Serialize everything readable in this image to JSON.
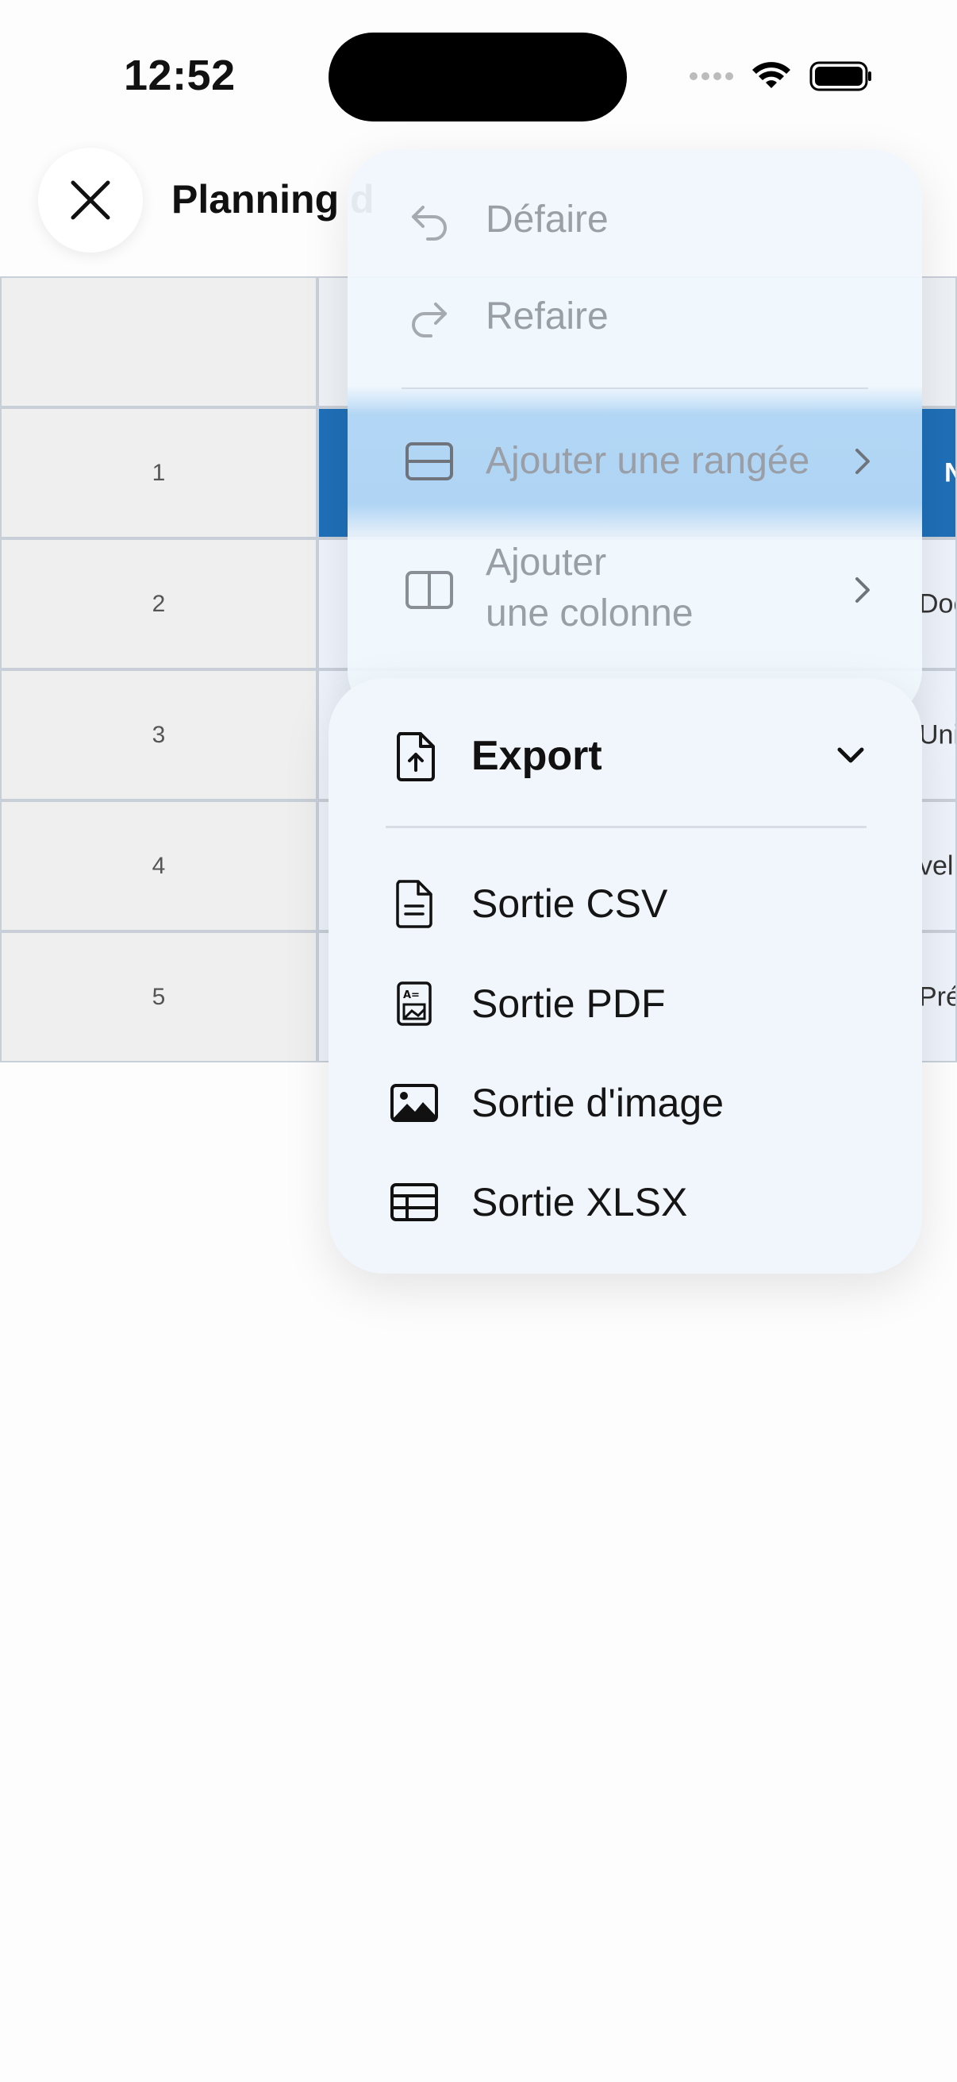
{
  "status_bar": {
    "time": "12:52"
  },
  "header": {
    "title": "Planning d"
  },
  "grid": {
    "row_numbers": [
      "1",
      "2",
      "3",
      "4",
      "5"
    ],
    "cell_peeks": [
      "N",
      "Doc",
      "Uni",
      "vel",
      "Pré"
    ],
    "selected_row": "1"
  },
  "menu": {
    "undo_label": "Défaire",
    "redo_label": "Refaire",
    "add_row_label": "Ajouter une rangée",
    "add_column_line1": "Ajouter",
    "add_column_line2": "une colonne"
  },
  "export": {
    "title": "Export",
    "items": [
      {
        "label": "Sortie CSV",
        "icon": "csv-file-icon"
      },
      {
        "label": "Sortie PDF",
        "icon": "pdf-file-icon"
      },
      {
        "label": "Sortie d'image",
        "icon": "image-icon"
      },
      {
        "label": "Sortie XLSX",
        "icon": "table-icon"
      }
    ]
  },
  "colors": {
    "selected_cell": "#1f6fb8",
    "highlight": "#aad2f4",
    "disabled_text": "#9a9ea6"
  }
}
